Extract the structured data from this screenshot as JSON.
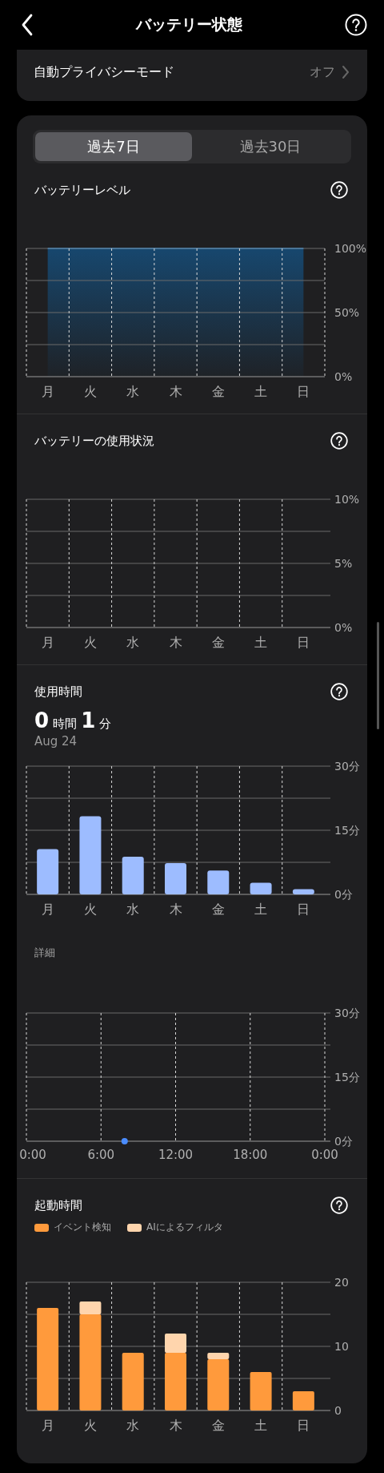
{
  "header": {
    "title": "バッテリー状態"
  },
  "privacy_row": {
    "label": "自動プライバシーモード",
    "value": "オフ"
  },
  "tabs": [
    {
      "label": "過去7日",
      "selected": true
    },
    {
      "label": "過去30日",
      "selected": false
    }
  ],
  "sections": [
    {
      "title": "バッテリーレベル",
      "chart_data": {
        "type": "area",
        "grid": true,
        "categories": [
          "月",
          "火",
          "水",
          "木",
          "金",
          "土",
          "日"
        ],
        "values": [
          100,
          100,
          100,
          100,
          100,
          100,
          100
        ],
        "ylim": [
          0,
          100
        ],
        "yticks": [
          {
            "value": 0,
            "label": "0%"
          },
          {
            "value": 50,
            "label": "50%"
          },
          {
            "value": 100,
            "label": "100%"
          }
        ]
      }
    },
    {
      "title": "バッテリーの使用状況",
      "chart_data": {
        "type": "bar",
        "grid": true,
        "categories": [
          "月",
          "火",
          "水",
          "木",
          "金",
          "土",
          "日"
        ],
        "values": [
          null,
          null,
          null,
          null,
          null,
          null,
          null
        ],
        "ylim": [
          0,
          10
        ],
        "yticks": [
          {
            "value": 0,
            "label": "0%"
          },
          {
            "value": 5,
            "label": "5%"
          },
          {
            "value": 10,
            "label": "10%"
          }
        ]
      }
    },
    {
      "title": "使用時間",
      "total": {
        "hours": "0",
        "hours_unit": "時間",
        "minutes": "1",
        "minutes_unit": "分"
      },
      "date": "Aug 24",
      "chart_data": {
        "type": "bar",
        "grid": true,
        "categories": [
          "月",
          "火",
          "水",
          "木",
          "金",
          "土",
          "日"
        ],
        "values": [
          10.6,
          18.3,
          8.8,
          7.3,
          5.6,
          2.7,
          1.2
        ],
        "ylim": [
          0,
          30
        ],
        "yticks": [
          {
            "value": 0,
            "label": "0分"
          },
          {
            "value": 15,
            "label": "15分"
          },
          {
            "value": 30,
            "label": "30分"
          }
        ]
      },
      "detail": {
        "title": "詳細",
        "chart_data": {
          "type": "scatter",
          "grid": true,
          "x": [
            7.9
          ],
          "values": [
            0
          ],
          "xlim": [
            0,
            24
          ],
          "xticks": [
            {
              "value": 0,
              "label": "0:00"
            },
            {
              "value": 6,
              "label": "6:00"
            },
            {
              "value": 12,
              "label": "12:00"
            },
            {
              "value": 18,
              "label": "18:00"
            },
            {
              "value": 24,
              "label": "0:00"
            }
          ],
          "ylim": [
            0,
            30
          ],
          "yticks": [
            {
              "value": 0,
              "label": "0分"
            },
            {
              "value": 15,
              "label": "15分"
            },
            {
              "value": 30,
              "label": "30分"
            }
          ]
        }
      }
    },
    {
      "title": "起動時間",
      "chart_data": {
        "type": "bar",
        "grid": true,
        "stacked": true,
        "categories": [
          "月",
          "火",
          "水",
          "木",
          "金",
          "土",
          "日"
        ],
        "series": [
          {
            "name": "イベント検知",
            "color": "#ff9a3c",
            "values": [
              16,
              15,
              9,
              9,
              8,
              6,
              3
            ]
          },
          {
            "name": "AIによるフィルタ",
            "color": "#ffd5ad",
            "values": [
              0,
              2,
              0,
              3,
              1,
              0,
              0
            ]
          }
        ],
        "ylim": [
          0,
          20
        ],
        "yticks": [
          {
            "value": 0,
            "label": "0"
          },
          {
            "value": 10,
            "label": "10"
          },
          {
            "value": 20,
            "label": "20"
          }
        ]
      }
    }
  ]
}
